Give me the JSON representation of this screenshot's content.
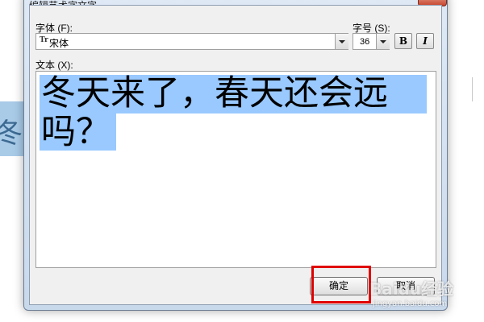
{
  "dialog": {
    "title": "编辑艺术字文字",
    "font_label": "字体 (F):",
    "font_value": "宋体",
    "font_icon": "Tr",
    "size_label": "字号 (S):",
    "size_value": "36",
    "bold_label": "B",
    "italic_label": "I",
    "text_label": "文本 (X):",
    "text_line1": "冬天来了，春天还会远",
    "text_line2": "吗？",
    "ok_label": "确定",
    "cancel_label": "取消"
  },
  "background": {
    "selected_fragment": "冬"
  },
  "watermark": {
    "text": "Baidu经验",
    "sub": "jingyan.baidu.com"
  },
  "colors": {
    "selection": "#99c9ff",
    "highlight_box": "#e00000"
  }
}
